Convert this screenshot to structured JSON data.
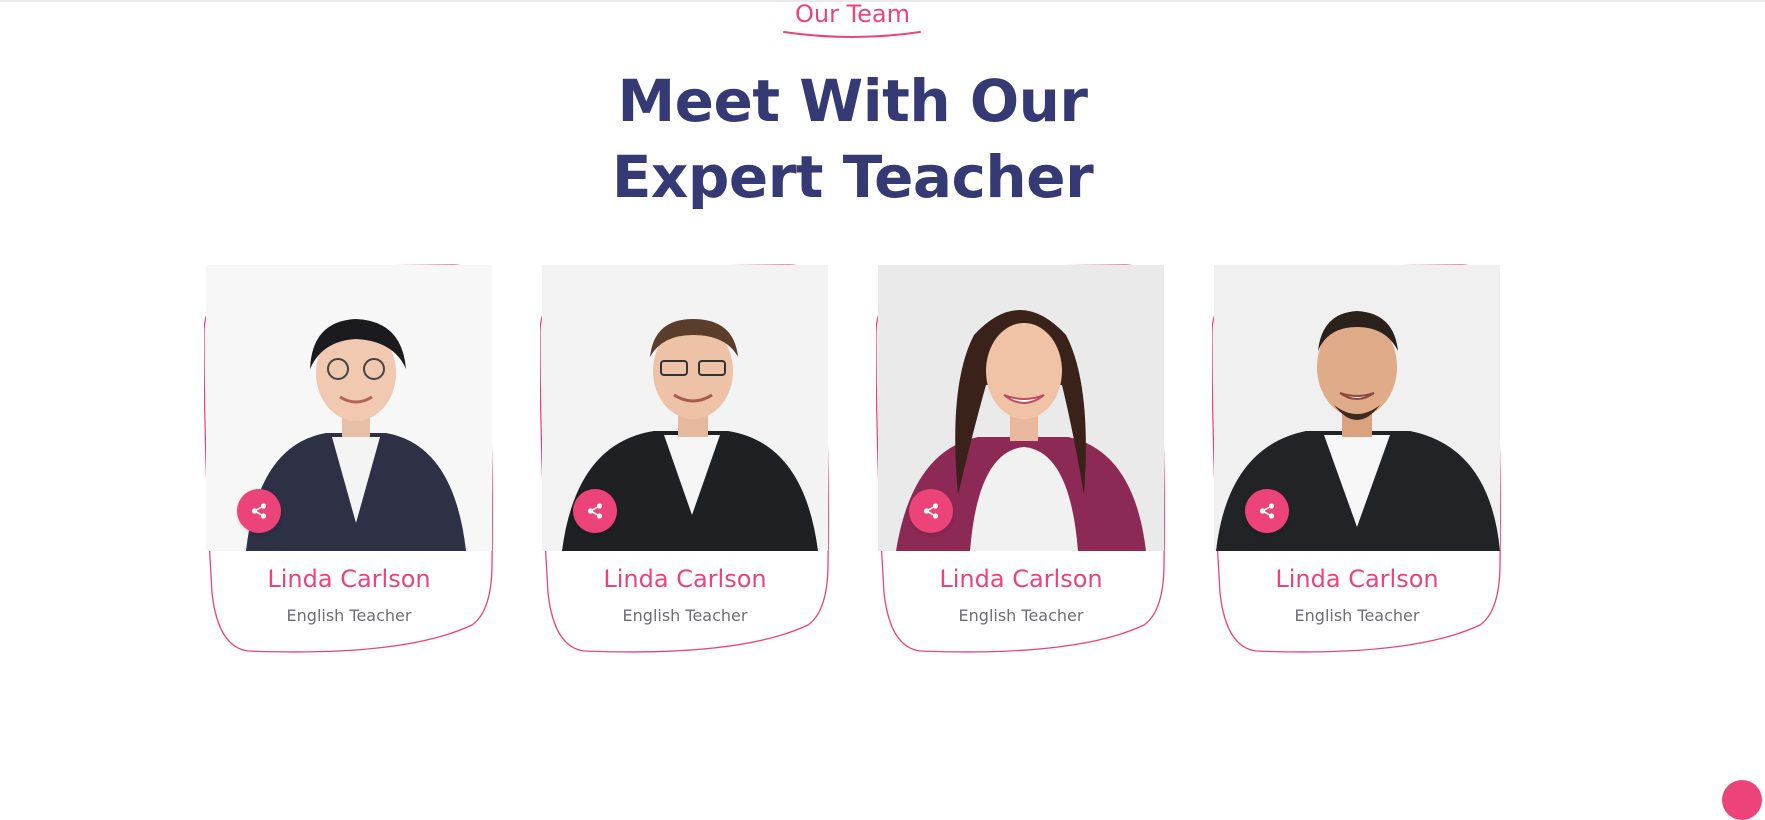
{
  "section": {
    "eyebrow": "Our Team",
    "title_line1": "Meet With Our",
    "title_line2": "Expert Teacher"
  },
  "team": [
    {
      "name": "Linda Carlson",
      "role": "English Teacher",
      "share_icon": "share-icon"
    },
    {
      "name": "Linda Carlson",
      "role": "English Teacher",
      "share_icon": "share-icon"
    },
    {
      "name": "Linda Carlson",
      "role": "English Teacher",
      "share_icon": "share-icon"
    },
    {
      "name": "Linda Carlson",
      "role": "English Teacher",
      "share_icon": "share-icon"
    }
  ],
  "colors": {
    "accent": "#ec4379",
    "heading": "#363a74",
    "muted_text": "#6e6e76",
    "background": "#ffffff"
  }
}
